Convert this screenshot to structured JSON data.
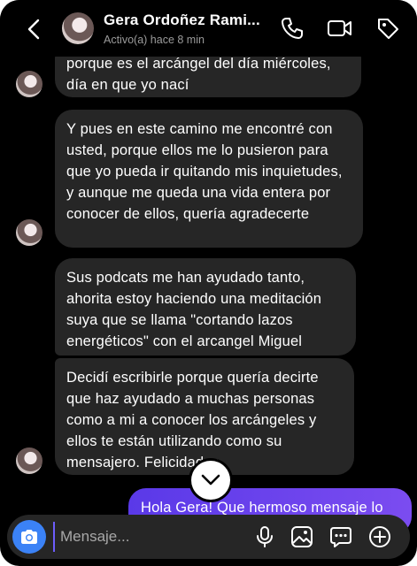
{
  "header": {
    "contact_name": "Gera Ordoñez Rami...",
    "status": "Activo(a) hace 8 min"
  },
  "messages": [
    {
      "from": "them",
      "text": "porque es el arcángel del día miércoles, día en que yo nací"
    },
    {
      "from": "them",
      "text": "Y pues en este camino me encontré con usted, porque ellos me lo pusieron para que yo pueda ir quitando mis inquietudes, y aunque me queda una vida entera por conocer de ellos, quería agradecerte"
    },
    {
      "from": "them",
      "text": "Sus podcats me han ayudado tanto, ahorita estoy haciendo una meditación suya que se llama \"cortando lazos energéticos\" con el arcangel Miguel"
    },
    {
      "from": "them",
      "text": "Decidí escribirle porque quería decirte que haz ayudado a muchas personas como a mi a conocer los arcángeles y ellos te están utilizando como su mensajero. Felicidades"
    },
    {
      "from": "me",
      "text": "Hola Gera! Que hermoso mensaje lo"
    }
  ],
  "composer": {
    "placeholder": "Mensaje..."
  },
  "colors": {
    "background": "#000000",
    "received_bubble": "#262626",
    "sent_bubble": "#6a42ee",
    "camera_button": "#3b82f6"
  }
}
